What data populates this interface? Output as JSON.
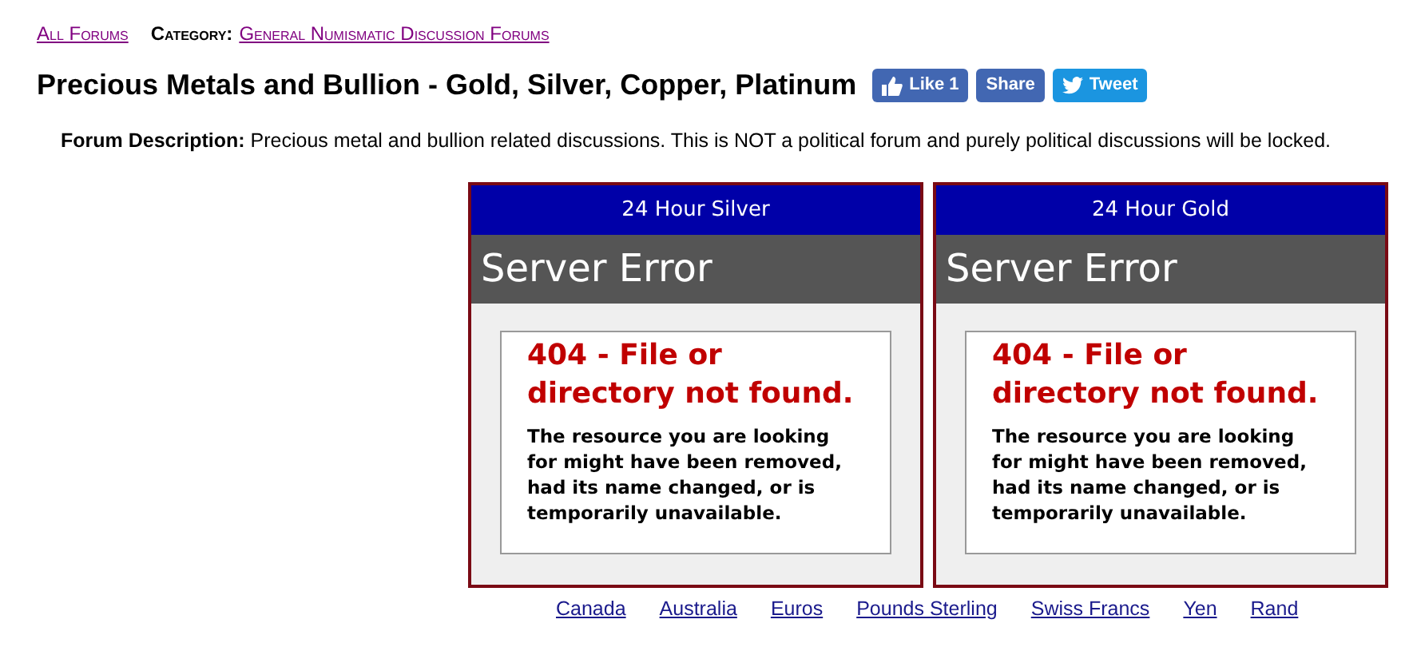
{
  "breadcrumb": {
    "all_forums": "All Forums",
    "category_label": "Category:",
    "category": "General Numismatic Discussion Forums"
  },
  "title": "Precious Metals and Bullion - Gold, Silver, Copper, Platinum",
  "social": [
    {
      "kind": "like",
      "label": "Like 1"
    },
    {
      "kind": "share",
      "label": "Share"
    },
    {
      "kind": "tweet",
      "label": "Tweet"
    }
  ],
  "description": {
    "label": "Forum Description:",
    "text": "Precious metal and bullion related discussions. This is NOT a political forum and purely political discussions will be locked."
  },
  "panels": [
    {
      "title": "24 Hour Silver",
      "error_title": "Server Error",
      "error_heading": "404 - File or directory not found.",
      "error_text": "The resource you are looking for might have been removed, had its name changed, or is temporarily unavailable."
    },
    {
      "title": "24 Hour Gold",
      "error_title": "Server Error",
      "error_heading": "404 - File or directory not found.",
      "error_text": "The resource you are looking for might have been removed, had its name changed, or is temporarily unavailable."
    }
  ],
  "currency_links": [
    "Canada",
    "Australia",
    "Euros",
    "Pounds Sterling",
    "Swiss Francs",
    "Yen",
    "Rand"
  ]
}
